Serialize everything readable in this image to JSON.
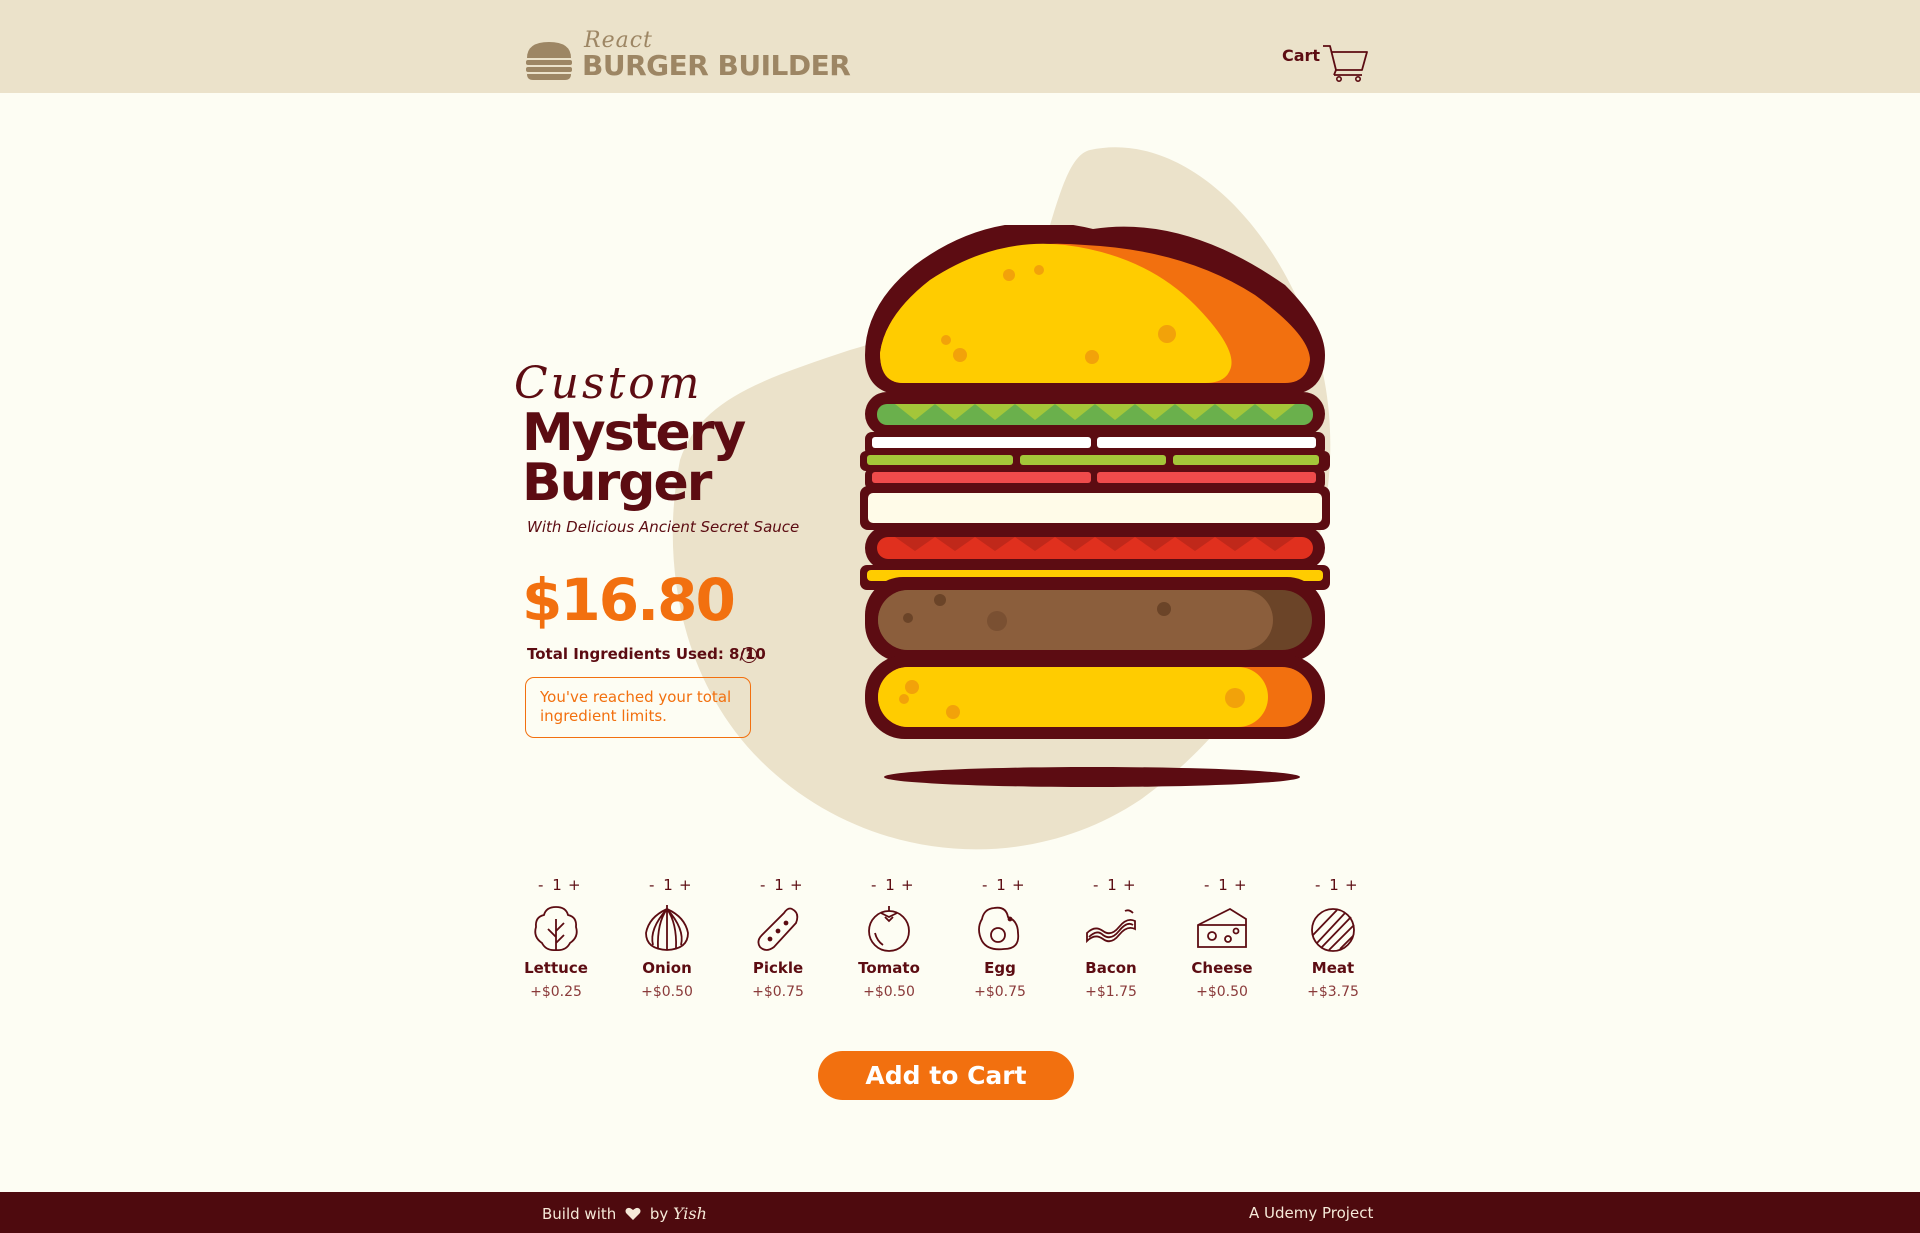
{
  "header": {
    "logo_small": "React",
    "logo_title": "BURGER BUILDER",
    "cart_label": "Cart"
  },
  "product": {
    "custom_label": "Custom",
    "name": "Mystery Burger",
    "subtitle": "With Delicious Ancient Secret Sauce",
    "price": "$16.80",
    "ingredients_used": "Total Ingredients Used: 8/10",
    "help_icon": "?",
    "limit_message": "You've reached your total ingredient limits."
  },
  "ingredients": [
    {
      "name": "Lettuce",
      "price": "+$0.25",
      "qty": "1",
      "minus": "-",
      "plus": "+",
      "icon": "lettuce-icon"
    },
    {
      "name": "Onion",
      "price": "+$0.50",
      "qty": "1",
      "minus": "-",
      "plus": "+",
      "icon": "onion-icon"
    },
    {
      "name": "Pickle",
      "price": "+$0.75",
      "qty": "1",
      "minus": "-",
      "plus": "+",
      "icon": "pickle-icon"
    },
    {
      "name": "Tomato",
      "price": "+$0.50",
      "qty": "1",
      "minus": "-",
      "plus": "+",
      "icon": "tomato-icon"
    },
    {
      "name": "Egg",
      "price": "+$0.75",
      "qty": "1",
      "minus": "-",
      "plus": "+",
      "icon": "egg-icon"
    },
    {
      "name": "Bacon",
      "price": "+$1.75",
      "qty": "1",
      "minus": "-",
      "plus": "+",
      "icon": "bacon-icon"
    },
    {
      "name": "Cheese",
      "price": "+$0.50",
      "qty": "1",
      "minus": "-",
      "plus": "+",
      "icon": "cheese-icon"
    },
    {
      "name": "Meat",
      "price": "+$3.75",
      "qty": "1",
      "minus": "-",
      "plus": "+",
      "icon": "meat-icon"
    }
  ],
  "actions": {
    "add_to_cart": "Add to Cart"
  },
  "footer": {
    "build_with": "Build with",
    "by": "by",
    "author": "Yish",
    "right": "A Udemy Project"
  },
  "colors": {
    "header_bg": "#ebe2ca",
    "page_bg": "#fdfdf3",
    "brand_dark": "#5c0c12",
    "accent_orange": "#f2700f",
    "footer_bg": "#4e0a0e"
  }
}
